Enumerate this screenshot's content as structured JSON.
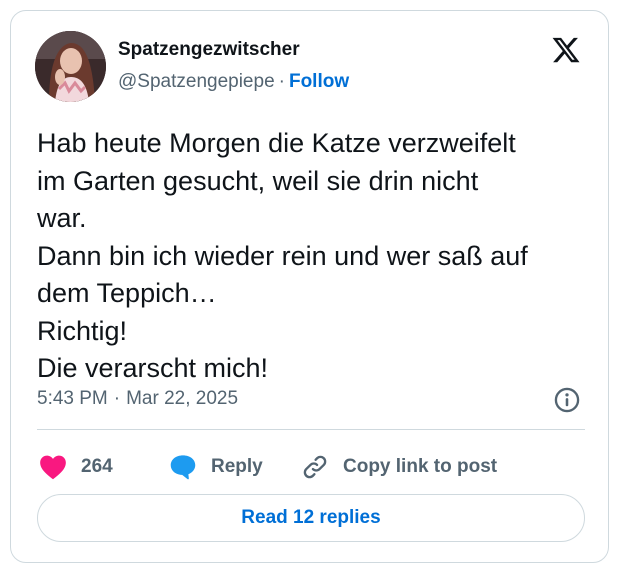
{
  "author": {
    "display_name": "Spatzengezwitscher",
    "handle": "@Spatzengepiepe",
    "separator": "·",
    "follow_label": "Follow"
  },
  "post": {
    "lines": [
      "Hab heute Morgen die Katze verzweifelt",
      "im Garten gesucht, weil sie drin nicht",
      "war.",
      "Dann bin ich wieder rein und wer saß auf",
      "dem Teppich…",
      "Richtig!",
      "Die verarscht mich!"
    ],
    "time": "5:43 PM",
    "separator": "·",
    "date": "Mar 22, 2025"
  },
  "actions": {
    "like_count": "264",
    "reply_label": "Reply",
    "copy_label": "Copy link to post"
  },
  "read_replies_label": "Read 12 replies",
  "icons": {
    "brand": "x-logo-icon",
    "like": "heart-icon",
    "reply": "speech-bubble-icon",
    "copy": "link-icon",
    "info": "info-icon"
  },
  "colors": {
    "text": "#0f1419",
    "secondary": "#536471",
    "accent": "#006fd6",
    "like": "#f91880",
    "reply": "#1d9bf0",
    "border": "#cfd9de"
  }
}
